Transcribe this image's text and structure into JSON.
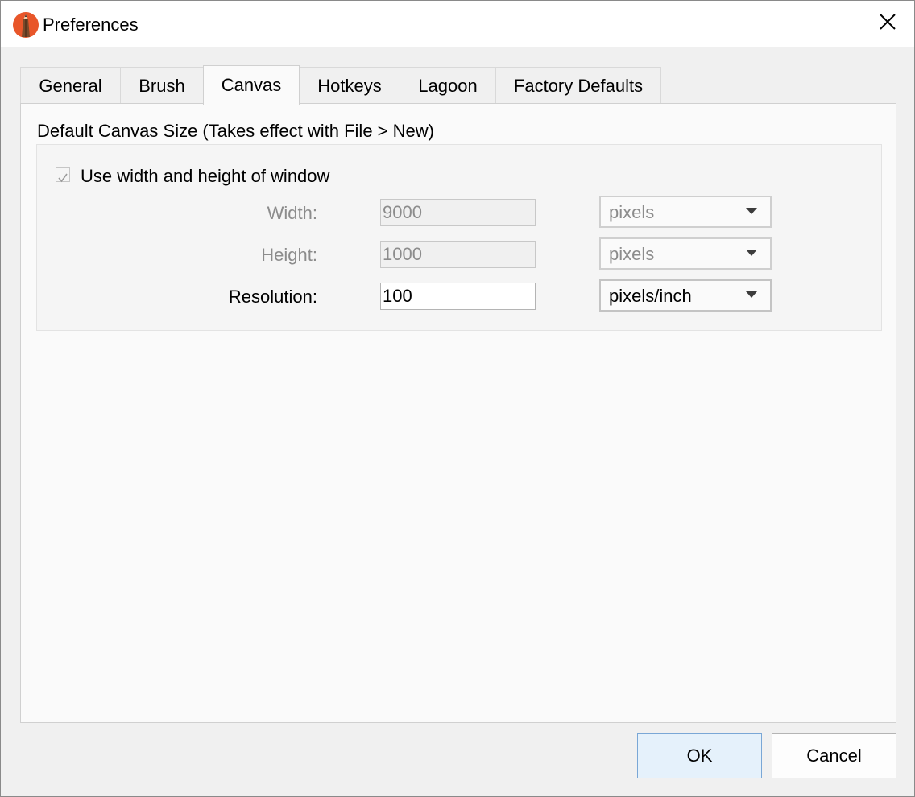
{
  "window": {
    "title": "Preferences",
    "app_icon": "pencil-app-icon",
    "close_icon": "close-icon"
  },
  "tabs": [
    {
      "label": "General",
      "active": false
    },
    {
      "label": "Brush",
      "active": false
    },
    {
      "label": "Canvas",
      "active": true
    },
    {
      "label": "Hotkeys",
      "active": false
    },
    {
      "label": "Lagoon",
      "active": false
    },
    {
      "label": "Factory Defaults",
      "active": false
    }
  ],
  "canvas": {
    "section_title": "Default Canvas Size (Takes effect with File > New)",
    "use_window_size": {
      "label": "Use width and height of window",
      "checked": true,
      "enabled": false
    },
    "width": {
      "label": "Width:",
      "value": "9000",
      "unit": "pixels",
      "enabled": false
    },
    "height": {
      "label": "Height:",
      "value": "1000",
      "unit": "pixels",
      "enabled": false
    },
    "resolution": {
      "label": "Resolution:",
      "value": "100",
      "unit": "pixels/inch",
      "enabled": true
    }
  },
  "buttons": {
    "ok": "OK",
    "cancel": "Cancel"
  },
  "colors": {
    "default_button_bg": "#e5f1fb",
    "default_button_border": "#7aa7d6",
    "disabled_text": "#8c8c8c"
  }
}
